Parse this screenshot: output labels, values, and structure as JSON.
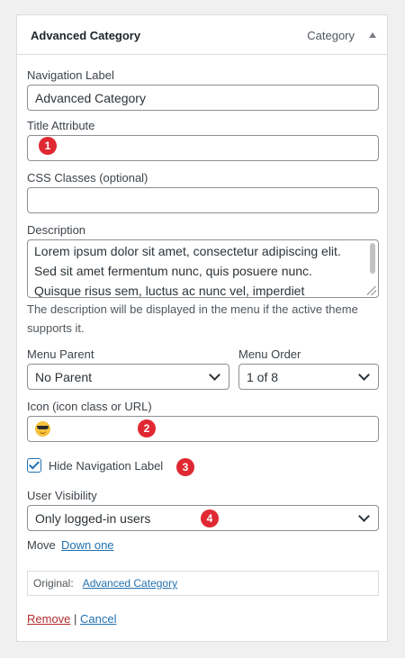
{
  "panel": {
    "title": "Advanced Category",
    "type_label": "Category"
  },
  "fields": {
    "navigation_label": {
      "label": "Navigation Label",
      "value": "Advanced Category"
    },
    "title_attribute": {
      "label": "Title Attribute",
      "value": ""
    },
    "css_classes": {
      "label": "CSS Classes (optional)",
      "value": ""
    },
    "description": {
      "label": "Description",
      "lines": [
        "Lorem ipsum dolor sit amet, consectetur adipiscing elit.",
        "Sed sit amet fermentum nunc, quis posuere nunc.",
        "Quisque risus sem, luctus ac nunc vel, imperdiet"
      ],
      "help_line1": "The description will be displayed in the menu if the active theme",
      "help_line2": "supports it."
    },
    "menu_parent": {
      "label": "Menu Parent",
      "value": "No Parent"
    },
    "menu_order": {
      "label": "Menu Order",
      "value": "1 of 8"
    },
    "icon": {
      "label": "Icon (icon class or URL)",
      "value_icon": "smiling-face-with-sunglasses-emoji"
    },
    "hide_nav_label": {
      "label": "Hide Navigation Label",
      "checked": true
    },
    "user_visibility": {
      "label": "User Visibility",
      "value": "Only logged-in users"
    }
  },
  "move": {
    "label": "Move",
    "link": "Down one"
  },
  "original": {
    "label": "Original:",
    "link": "Advanced Category"
  },
  "actions": {
    "remove": "Remove",
    "separator": "|",
    "cancel": "Cancel"
  },
  "badges": [
    "1",
    "2",
    "3",
    "4"
  ],
  "colors": {
    "accent": "#2271b1",
    "danger": "#b32d2e",
    "badge": "#e02832"
  }
}
